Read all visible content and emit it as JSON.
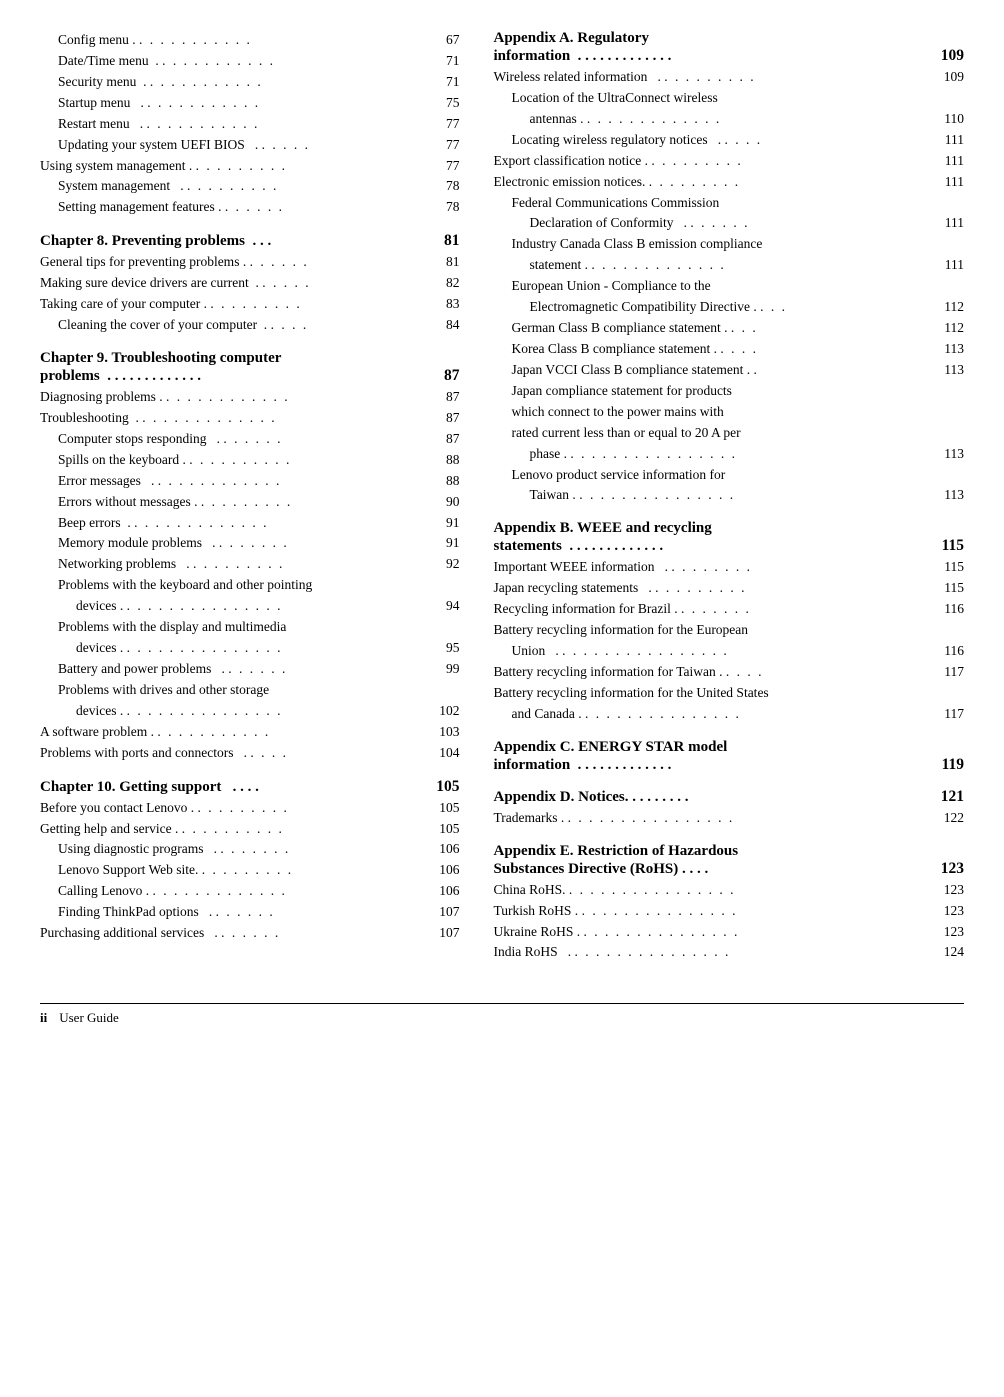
{
  "footer": {
    "page": "ii",
    "label": "User Guide"
  },
  "left_column": {
    "entries": [
      {
        "indent": 1,
        "text": "Config menu .",
        "dots": ". . . . . . . . . . .",
        "page": "67"
      },
      {
        "indent": 1,
        "text": "Date/Time menu .",
        "dots": ". . . . . . . . . . .",
        "page": "71"
      },
      {
        "indent": 1,
        "text": "Security menu .",
        "dots": ". . . . . . . . . . .",
        "page": "71"
      },
      {
        "indent": 1,
        "text": "Startup menu  .",
        "dots": ". . . . . . . . . . .",
        "page": "75"
      },
      {
        "indent": 1,
        "text": "Restart menu  .",
        "dots": ". . . . . . . . . . .",
        "page": "77"
      },
      {
        "indent": 1,
        "text": "Updating your system UEFI BIOS  .",
        "dots": ". . . . .",
        "page": "77"
      },
      {
        "indent": 0,
        "text": "Using system management .",
        "dots": ". . . . . . . . .",
        "page": "77"
      },
      {
        "indent": 1,
        "text": "System management  .",
        "dots": ". . . . . . . . .",
        "page": "78"
      },
      {
        "indent": 1,
        "text": "Setting management features .",
        "dots": ". . . . . .",
        "page": "78"
      }
    ],
    "chapters": [
      {
        "type": "chapter",
        "heading": "Chapter 8. Preventing problems  . . .",
        "page": "81",
        "entries": [
          {
            "indent": 0,
            "text": "General tips for preventing problems .",
            "dots": ". . . . . .",
            "page": "81"
          },
          {
            "indent": 0,
            "text": "Making sure device drivers are current  .",
            "dots": ". . . . .",
            "page": "82"
          },
          {
            "indent": 0,
            "text": "Taking care of your computer .",
            "dots": ". . . . . . . . .",
            "page": "83"
          },
          {
            "indent": 1,
            "text": "Cleaning the cover of your computer  .",
            "dots": ". . . .",
            "page": "84"
          }
        ]
      },
      {
        "type": "chapter",
        "heading": "Chapter 9. Troubleshooting computer",
        "heading2": "problems  . . . . . . . . . . . . .",
        "page": "87",
        "entries": [
          {
            "indent": 0,
            "text": "Diagnosing problems .",
            "dots": ". . . . . . . . . . . .",
            "page": "87"
          },
          {
            "indent": 0,
            "text": "Troubleshooting  .",
            "dots": ". . . . . . . . . . . . .",
            "page": "87"
          },
          {
            "indent": 1,
            "text": "Computer stops responding  .",
            "dots": ". . . . . .",
            "page": "87"
          },
          {
            "indent": 1,
            "text": "Spills on the keyboard .",
            "dots": ". . . . . . . . . .",
            "page": "88"
          },
          {
            "indent": 1,
            "text": "Error messages  .",
            "dots": ". . . . . . . . . . . .",
            "page": "88"
          },
          {
            "indent": 1,
            "text": "Errors without messages .",
            "dots": ". . . . . . . . .",
            "page": "90"
          },
          {
            "indent": 1,
            "text": "Beep errors  .",
            "dots": ". . . . . . . . . . . . .",
            "page": "91"
          },
          {
            "indent": 1,
            "text": "Memory module problems  .",
            "dots": ". . . . . . .",
            "page": "91"
          },
          {
            "indent": 1,
            "text": "Networking problems  .",
            "dots": ". . . . . . . . .",
            "page": "92"
          },
          {
            "indent": 1,
            "text": "Problems with the keyboard and other pointing\ndevices .",
            "dots": ". . . . . . . . . . . . . . .",
            "page": "94",
            "multiline": true
          },
          {
            "indent": 1,
            "text": "Problems with the display and multimedia\ndevices .",
            "dots": ". . . . . . . . . . . . . . .",
            "page": "95",
            "multiline": true
          },
          {
            "indent": 1,
            "text": "Battery and power problems  .",
            "dots": ". . . . . .",
            "page": "99"
          },
          {
            "indent": 1,
            "text": "Problems with drives and other storage\ndevices .",
            "dots": ". . . . . . . . . . . . . . .",
            "page": "102",
            "multiline": true
          },
          {
            "indent": 0,
            "text": "A software problem .",
            "dots": ". . . . . . . . . . .",
            "page": "103"
          },
          {
            "indent": 0,
            "text": "Problems with ports and connectors  .",
            "dots": ". . . .",
            "page": "104"
          }
        ]
      },
      {
        "type": "chapter",
        "heading": "Chapter 10. Getting support  . . . .",
        "page": "105",
        "entries": [
          {
            "indent": 0,
            "text": "Before you contact Lenovo .",
            "dots": ". . . . . . . . .",
            "page": "105"
          },
          {
            "indent": 0,
            "text": "Getting help and service .",
            "dots": ". . . . . . . . . .",
            "page": "105"
          },
          {
            "indent": 1,
            "text": "Using diagnostic programs  .",
            "dots": ". . . . . . .",
            "page": "106"
          },
          {
            "indent": 1,
            "text": "Lenovo Support Web site.",
            "dots": ". . . . . . . . .",
            "page": "106"
          },
          {
            "indent": 1,
            "text": "Calling Lenovo .",
            "dots": ". . . . . . . . . . . . .",
            "page": "106"
          },
          {
            "indent": 1,
            "text": "Finding ThinkPad options  .",
            "dots": ". . . . . .",
            "page": "107"
          },
          {
            "indent": 0,
            "text": "Purchasing additional services  .",
            "dots": ". . . . . .",
            "page": "107"
          }
        ]
      }
    ]
  },
  "right_column": {
    "appendices": [
      {
        "heading": "Appendix A. Regulatory\ninformation  . . . . . . . . . . . . .",
        "page": "109",
        "entries": [
          {
            "indent": 0,
            "text": "Wireless related information  .",
            "dots": ". . . . . . . . .",
            "page": "109"
          },
          {
            "indent": 1,
            "text": "Location of the UltraConnect wireless\nantennas .",
            "dots": ". . . . . . . . . . . . . .",
            "page": "110",
            "multiline": true
          },
          {
            "indent": 1,
            "text": "Locating wireless regulatory notices  .",
            "dots": ". . . .",
            "page": "111"
          },
          {
            "indent": 0,
            "text": "Export classification notice .",
            "dots": ". . . . . . . . .",
            "page": "111"
          },
          {
            "indent": 0,
            "text": "Electronic emission notices.",
            "dots": ". . . . . . . . .",
            "page": "111"
          },
          {
            "indent": 1,
            "text": "Federal Communications Commission\nDeclaration of Conformity  .",
            "dots": ". . . . . .",
            "page": "111",
            "multiline": true
          },
          {
            "indent": 1,
            "text": "Industry Canada Class B emission compliance\nstatement .",
            "dots": ". . . . . . . . . . . . . .",
            "page": "111",
            "multiline": true
          },
          {
            "indent": 1,
            "text": "European Union - Compliance to the\nElectromagnetic Compatibility Directive .",
            "dots": ". . .",
            "page": "112",
            "multiline": true
          },
          {
            "indent": 1,
            "text": "German Class B compliance statement .",
            "dots": ". . .",
            "page": "112"
          },
          {
            "indent": 1,
            "text": "Korea Class B compliance statement .",
            "dots": ". . . .",
            "page": "113"
          },
          {
            "indent": 1,
            "text": "Japan VCCI Class B compliance statement .",
            "dots": ".",
            "page": "113"
          },
          {
            "indent": 1,
            "text": "Japan compliance statement for products\nwhich connect to the power mains with\nrated current less than or equal to 20 A per\nphase .",
            "dots": ". . . . . . . . . . . . . . . .",
            "page": "113",
            "multiline": true
          },
          {
            "indent": 1,
            "text": "Lenovo product service information for\nTaiwan .",
            "dots": ". . . . . . . . . . . . . . .",
            "page": "113",
            "multiline": true
          }
        ]
      },
      {
        "heading": "Appendix B. WEEE and recycling\nstatements  . . . . . . . . . . . . .",
        "page": "115",
        "entries": [
          {
            "indent": 0,
            "text": "Important WEEE information  .",
            "dots": ". . . . . . . .",
            "page": "115"
          },
          {
            "indent": 0,
            "text": "Japan recycling statements  .",
            "dots": ". . . . . . . . .",
            "page": "115"
          },
          {
            "indent": 0,
            "text": "Recycling information for Brazil .",
            "dots": ". . . . . . .",
            "page": "116"
          },
          {
            "indent": 0,
            "text": "Battery recycling information for the European\nUnion  .",
            "dots": ". . . . . . . . . . . . . . . .",
            "page": "116",
            "multiline": true
          },
          {
            "indent": 0,
            "text": "Battery recycling information for Taiwan .",
            "dots": ". . . .",
            "page": "117"
          },
          {
            "indent": 0,
            "text": "Battery recycling information for the United States\nand Canada .",
            "dots": ". . . . . . . . . . . . . . .",
            "page": "117",
            "multiline": true
          }
        ]
      },
      {
        "heading": "Appendix C. ENERGY STAR model\ninformation  . . . . . . . . . . . . .",
        "page": "119",
        "entries": []
      },
      {
        "heading": "Appendix D. Notices. . . . . . . . .",
        "page": "121",
        "entries": [
          {
            "indent": 0,
            "text": "Trademarks .",
            "dots": ". . . . . . . . . . . . . . . .",
            "page": "122"
          }
        ]
      },
      {
        "heading": "Appendix E. Restriction of Hazardous\nSubstances Directive (RoHS) . . . .",
        "page": "123",
        "entries": [
          {
            "indent": 0,
            "text": "China RoHS.",
            "dots": ". . . . . . . . . . . . . . . .",
            "page": "123"
          },
          {
            "indent": 0,
            "text": "Turkish RoHS .",
            "dots": ". . . . . . . . . . . . . . .",
            "page": "123"
          },
          {
            "indent": 0,
            "text": "Ukraine RoHS .",
            "dots": ". . . . . . . . . . . . . . .",
            "page": "123"
          },
          {
            "indent": 0,
            "text": "India RoHS  .",
            "dots": ". . . . . . . . . . . . . . .",
            "page": "124"
          }
        ]
      }
    ]
  }
}
